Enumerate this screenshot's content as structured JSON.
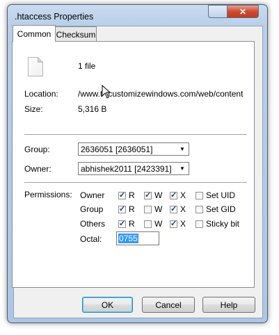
{
  "window": {
    "title": ".htaccess Properties",
    "close_glyph": "✕",
    "minimize_glyph": "▭"
  },
  "tabs": [
    {
      "label": "Common",
      "active": true
    },
    {
      "label": "Checksum",
      "active": false
    }
  ],
  "file": {
    "count_label": "1 file",
    "icon": "document-icon"
  },
  "info": {
    "location_label": "Location:",
    "location_value": "/www.t",
    "location_value_rest": "customizewindows.com/web/content",
    "size_label": "Size:",
    "size_value": "5,316 B"
  },
  "group": {
    "label": "Group:",
    "value": "2636051 [2636051]"
  },
  "owner": {
    "label": "Owner:",
    "value": "abhishek2011 [2423391]"
  },
  "permissions": {
    "label": "Permissions:",
    "rows": [
      {
        "name": "Owner",
        "r": true,
        "w": true,
        "x": true,
        "extra_label": "Set UID",
        "extra": false
      },
      {
        "name": "Group",
        "r": true,
        "w": false,
        "x": true,
        "extra_label": "Set GID",
        "extra": false
      },
      {
        "name": "Others",
        "r": true,
        "w": false,
        "x": true,
        "extra_label": "Sticky bit",
        "extra": false
      }
    ],
    "r_label": "R",
    "w_label": "W",
    "x_label": "X",
    "octal_label": "Octal:",
    "octal_value": "0755"
  },
  "buttons": {
    "ok": "OK",
    "cancel": "Cancel",
    "help": "Help"
  }
}
